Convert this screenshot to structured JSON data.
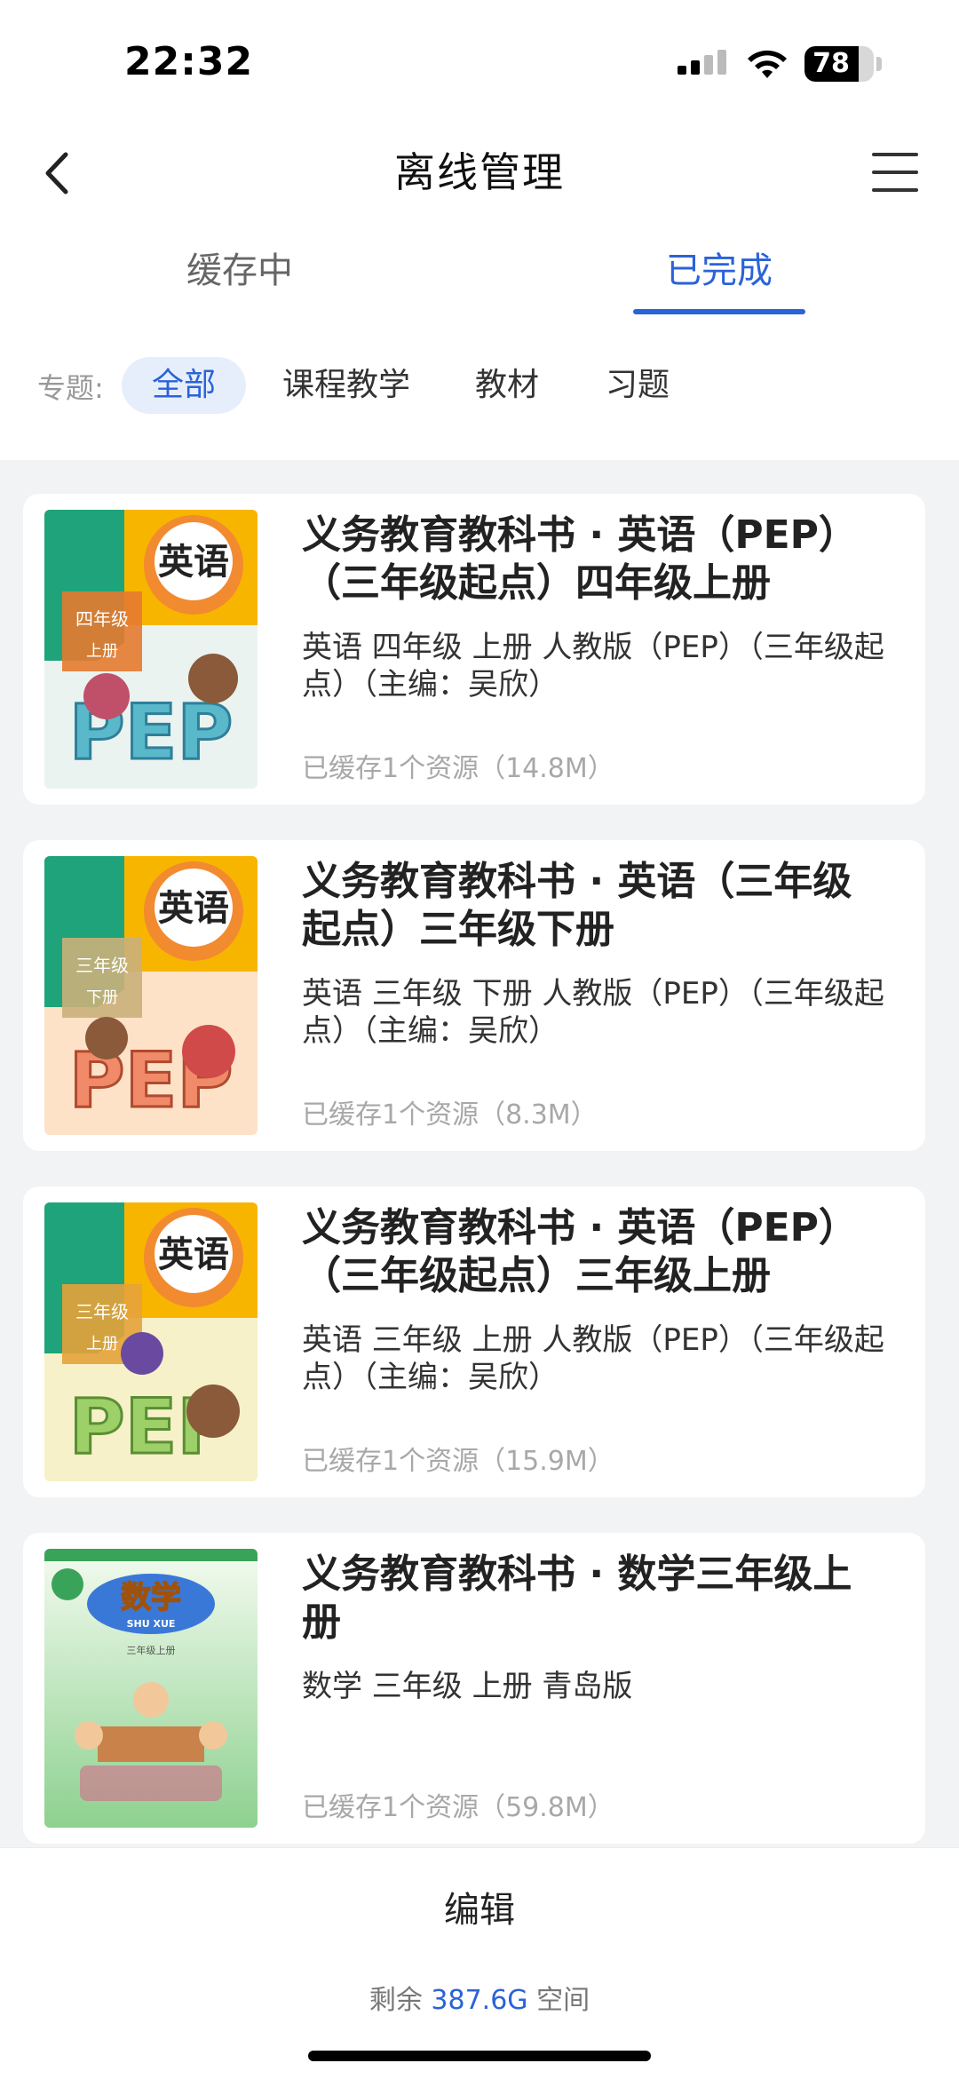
{
  "status_bar": {
    "time": "22:32",
    "battery": "78",
    "battery_level": 0.78
  },
  "nav": {
    "title": "离线管理"
  },
  "tabs": [
    {
      "label": "缓存中"
    },
    {
      "label": "已完成"
    }
  ],
  "filter": {
    "label": "专题:",
    "chips": [
      {
        "label": "全部"
      },
      {
        "label": "课程教学"
      },
      {
        "label": "教材"
      },
      {
        "label": "习题"
      }
    ]
  },
  "items": [
    {
      "title": "义务教育教科书 · 英语（PEP）（三年级起点）四年级上册",
      "desc": "英语 四年级 上册 人教版（PEP）（三年级起点）（主编：吴欣）",
      "status": "已缓存1个资源（14.8M）",
      "cover": {
        "subject": "英语",
        "grade": "四年级",
        "term": "上册",
        "letters": "PEP"
      }
    },
    {
      "title": "义务教育教科书 · 英语（三年级起点）三年级下册",
      "desc": "英语 三年级 下册 人教版（PEP）（三年级起点）（主编：吴欣）",
      "status": "已缓存1个资源（8.3M）",
      "cover": {
        "subject": "英语",
        "grade": "三年级",
        "term": "下册",
        "letters": "PEP"
      }
    },
    {
      "title": "义务教育教科书 · 英语（PEP）（三年级起点）三年级上册",
      "desc": "英语 三年级 上册 人教版（PEP）（三年级起点）（主编：吴欣）",
      "status": "已缓存1个资源（15.9M）",
      "cover": {
        "subject": "英语",
        "grade": "三年级",
        "term": "上册",
        "letters": "PEP"
      }
    },
    {
      "title": "义务教育教科书 · 数学三年级上册",
      "desc": "数学 三年级 上册 青岛版",
      "status": "已缓存1个资源（59.8M）",
      "cover": {
        "subject": "数学",
        "pinyin": "SHU XUE",
        "grade": "三年级上册"
      }
    }
  ],
  "bottom": {
    "edit_label": "编辑",
    "storage_prefix": "剩余",
    "storage_value": "387.6G",
    "storage_suffix": "空间"
  },
  "colors": {
    "accent": "#2a63d8",
    "english_cover": "#f7b500",
    "math_cover": "#8dd18f"
  }
}
